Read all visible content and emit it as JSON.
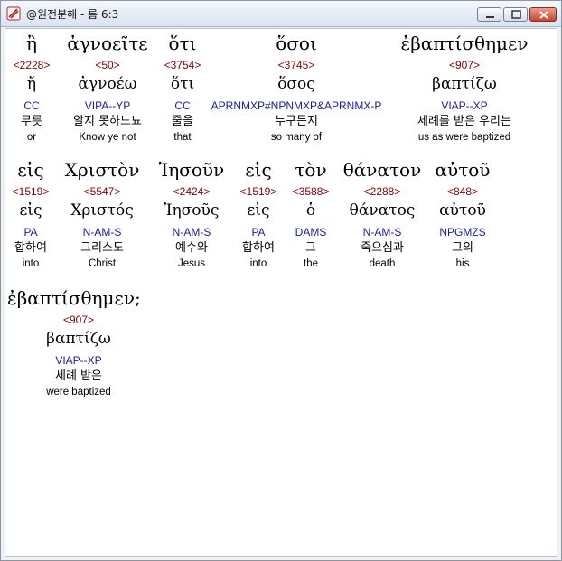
{
  "window": {
    "title": "@원전분해 - 롬 6:3"
  },
  "words": [
    {
      "greek": "ἢ",
      "strong": "<2228>",
      "lemma": "ἤ",
      "parse": "CC",
      "korean": "무릇",
      "english": "or"
    },
    {
      "greek": "ἀγνοεῖτε",
      "strong": "<50>",
      "lemma": "ἀγνοέω",
      "parse": "VIPA--YP",
      "korean": "알지 못하느뇨",
      "english": "Know ye not"
    },
    {
      "greek": "ὅτι",
      "strong": "<3754>",
      "lemma": "ὅτι",
      "parse": "CC",
      "korean": "줄을",
      "english": "that"
    },
    {
      "greek": "ὅσοι",
      "strong": "<3745>",
      "lemma": "ὅσος",
      "parse": "APRNMXP#NPNMXP&APRNMX-P",
      "korean": "누구든지",
      "english": "so many of"
    },
    {
      "greek": "ἐβαπτίσθημεν",
      "strong": "<907>",
      "lemma": "βαπτίζω",
      "parse": "VIAP--XP",
      "korean": "세례를 받은 우리는",
      "english": "us as were baptized"
    },
    {
      "greek": "εἰς",
      "strong": "<1519>",
      "lemma": "εἰς",
      "parse": "PA",
      "korean": "합하여",
      "english": "into"
    },
    {
      "greek": "Χριστὸν",
      "strong": "<5547>",
      "lemma": "Χριστός",
      "parse": "N-AM-S",
      "korean": "그리스도",
      "english": "Christ"
    },
    {
      "greek": "Ἰησοῦν",
      "strong": "<2424>",
      "lemma": "Ἰησοῦς",
      "parse": "N-AM-S",
      "korean": "예수와",
      "english": "Jesus"
    },
    {
      "greek": "εἰς",
      "strong": "<1519>",
      "lemma": "εἰς",
      "parse": "PA",
      "korean": "합하여",
      "english": "into"
    },
    {
      "greek": "τὸν",
      "strong": "<3588>",
      "lemma": "ὁ",
      "parse": "DAMS",
      "korean": "그",
      "english": "the"
    },
    {
      "greek": "θάνατον",
      "strong": "<2288>",
      "lemma": "θάνατος",
      "parse": "N-AM-S",
      "korean": "죽으심과",
      "english": "death"
    },
    {
      "greek": "αὐτοῦ",
      "strong": "<848>",
      "lemma": "αὐτοῦ",
      "parse": "NPGMZS",
      "korean": "그의",
      "english": "his"
    },
    {
      "greek": "ἐβαπτίσθημεν;",
      "strong": "<907>",
      "lemma": "βαπτίζω",
      "parse": "VIAP--XP",
      "korean": "세례 받은",
      "english": "were baptized"
    }
  ]
}
